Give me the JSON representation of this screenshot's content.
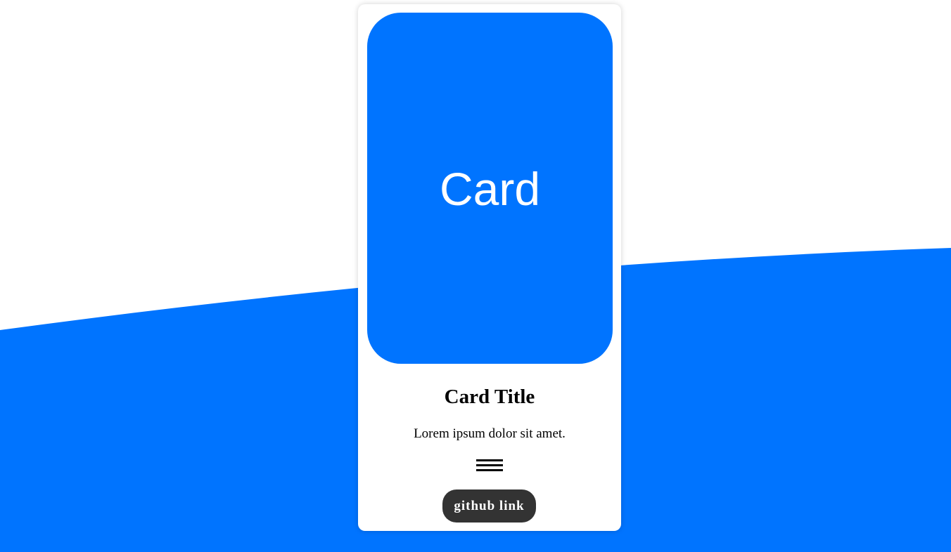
{
  "colors": {
    "accent": "#0074FF",
    "card_background": "#FFFFFF",
    "button_background": "#333333",
    "button_text": "#FFFFFF",
    "text": "#000000"
  },
  "card": {
    "image_label": "Card",
    "title": "Card Title",
    "text": "Lorem ipsum dolor sit amet.",
    "menu_icon": "menu-icon",
    "button_label": "github link"
  }
}
